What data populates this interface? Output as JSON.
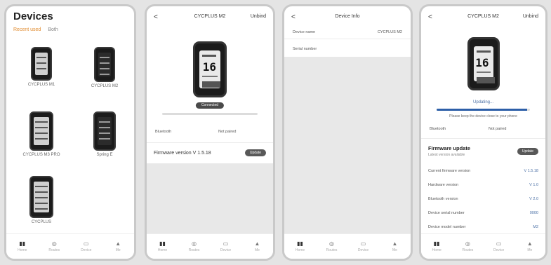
{
  "screen1": {
    "title": "Devices",
    "tabs": [
      "Recent used",
      "Both"
    ],
    "devices": [
      {
        "name": "CYCPLUS M1"
      },
      {
        "name": "CYCPLUS M2"
      },
      {
        "name": "CYCPLUS M3 PRO"
      },
      {
        "name": "Spring E"
      },
      {
        "name": "CYCPLUS"
      }
    ]
  },
  "screen2": {
    "back": "<",
    "title": "CYCPLUS M2",
    "right": "Unbind",
    "pill": "Connected",
    "big_num": "16",
    "left_label": "Bluetooth",
    "center_label": "Not paired",
    "firmware_label": "Firmware version V 1.5.18",
    "update_btn": "Update"
  },
  "screen3": {
    "back": "<",
    "title": "Device Info",
    "row1_left": "Device name",
    "row1_right": "CYCPLUS M2",
    "row2_left": "Serial number"
  },
  "screen4": {
    "back": "<",
    "title": "CYCPLUS M2",
    "right": "Unbind",
    "big_num": "16",
    "status": "Updating...",
    "progress": 0.97,
    "hint": "Please keep the device close to your phone",
    "left_label": "Bluetooth",
    "center_label": "Not paired",
    "fw_title": "Firmware update",
    "fw_sub": "Latest version available",
    "fw_btn": "Update",
    "info": [
      {
        "k": "Current firmware version",
        "v": "V 1.5.18"
      },
      {
        "k": "Hardware version",
        "v": "V 1.0"
      },
      {
        "k": "Bluetooth version",
        "v": "V 2.0"
      },
      {
        "k": "Device serial number",
        "v": "0000"
      },
      {
        "k": "Device model number",
        "v": "M2"
      }
    ]
  },
  "tabbar": [
    "Home",
    "Routes",
    "Device",
    "Me"
  ]
}
